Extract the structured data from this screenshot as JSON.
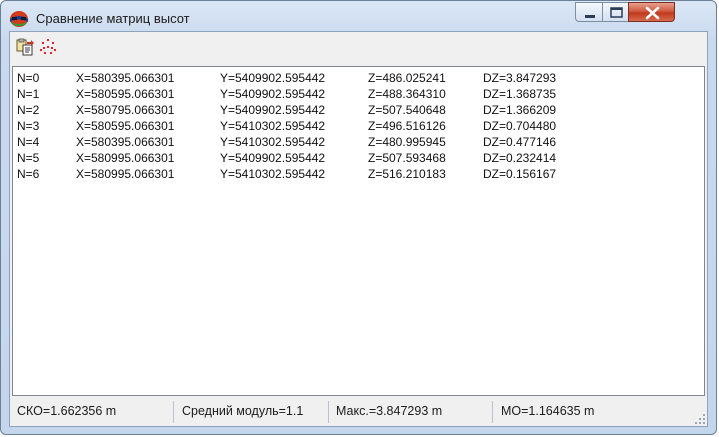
{
  "window": {
    "title": "Сравнение матриц высот"
  },
  "toolbar": {
    "buttons": [
      {
        "icon": "copy-to-clipboard-icon"
      },
      {
        "icon": "points-icon"
      }
    ]
  },
  "list": {
    "rows": [
      {
        "n": "N=0",
        "x": "X=580395.066301",
        "y": "Y=5409902.595442",
        "z": "Z=486.025241",
        "dz": "DZ=3.847293"
      },
      {
        "n": "N=1",
        "x": "X=580595.066301",
        "y": "Y=5409902.595442",
        "z": "Z=488.364310",
        "dz": "DZ=1.368735"
      },
      {
        "n": "N=2",
        "x": "X=580795.066301",
        "y": "Y=5409902.595442",
        "z": "Z=507.540648",
        "dz": "DZ=1.366209"
      },
      {
        "n": "N=3",
        "x": "X=580595.066301",
        "y": "Y=5410302.595442",
        "z": "Z=496.516126",
        "dz": "DZ=0.704480"
      },
      {
        "n": "N=4",
        "x": "X=580395.066301",
        "y": "Y=5410302.595442",
        "z": "Z=480.995945",
        "dz": "DZ=0.477146"
      },
      {
        "n": "N=5",
        "x": "X=580995.066301",
        "y": "Y=5409902.595442",
        "z": "Z=507.593468",
        "dz": "DZ=0.232414"
      },
      {
        "n": "N=6",
        "x": "X=580995.066301",
        "y": "Y=5410302.595442",
        "z": "Z=516.210183",
        "dz": "DZ=0.156167"
      }
    ]
  },
  "status": {
    "sko": "СКО=1.662356 m",
    "mean_abs": "Средний модуль=1.1",
    "max": "Макс.=3.847293 m",
    "mo": "МО=1.164635 m"
  }
}
